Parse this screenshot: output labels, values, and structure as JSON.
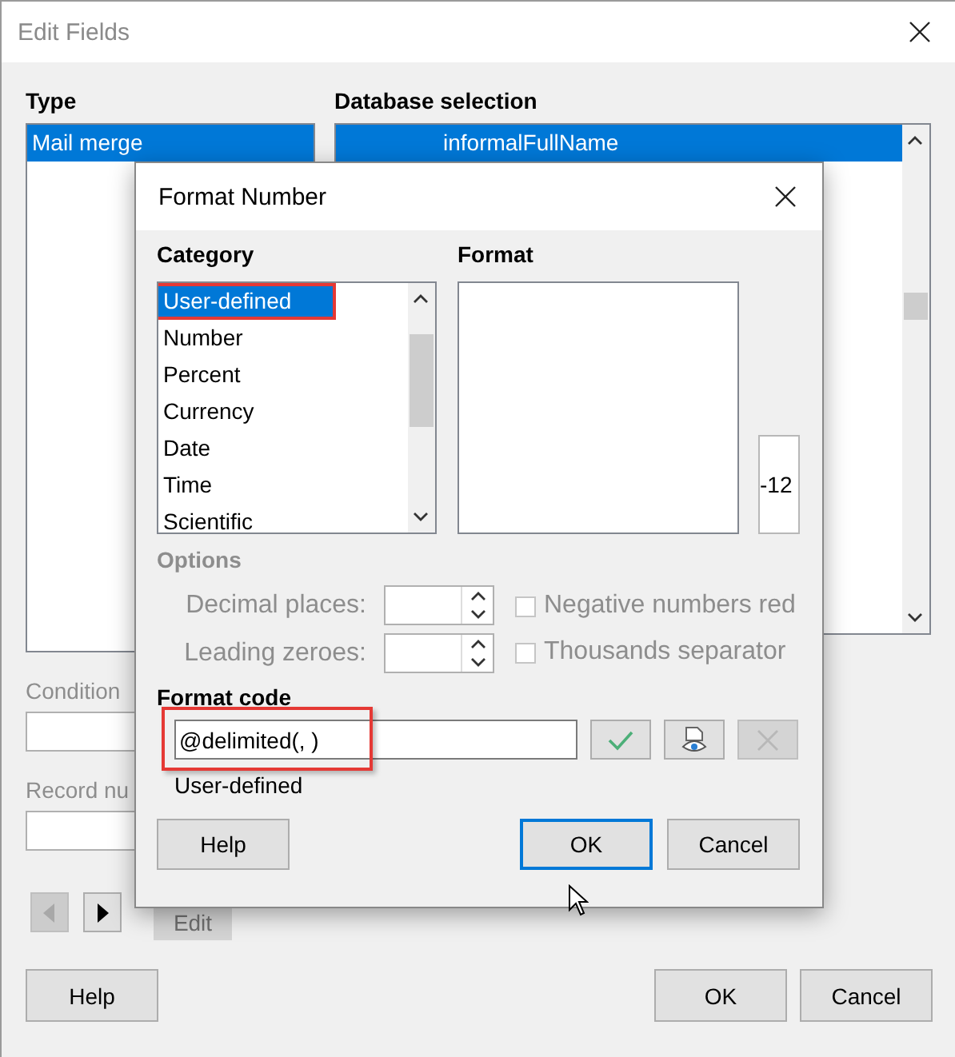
{
  "window": {
    "title": "Edit Fields"
  },
  "type_panel": {
    "label": "Type",
    "items": [
      {
        "label": "Mail merge",
        "selected": true
      }
    ]
  },
  "database_selection": {
    "label": "Database selection",
    "items": [
      {
        "label": "informalFullName",
        "selected": true
      }
    ]
  },
  "condition": {
    "label": "Condition"
  },
  "record_number": {
    "label": "Record nu"
  },
  "navigation": [
    {
      "kind": "previous",
      "disabled": true
    },
    {
      "kind": "next",
      "disabled": false
    }
  ],
  "edit_button": {
    "label": "Edit",
    "disabled": true
  },
  "buttons": [
    {
      "label": "Help",
      "kind": "help"
    },
    {
      "label": "OK",
      "kind": "action"
    },
    {
      "label": "Cancel",
      "kind": "action"
    }
  ],
  "format_number": {
    "title": "Format Number",
    "category": {
      "label": "Category",
      "items": [
        {
          "label": "User-defined",
          "selected": true,
          "highlighted": true
        },
        {
          "label": "Number",
          "selected": false,
          "highlighted": false
        },
        {
          "label": "Percent",
          "selected": false,
          "highlighted": false
        },
        {
          "label": "Currency",
          "selected": false,
          "highlighted": false
        },
        {
          "label": "Date",
          "selected": false,
          "highlighted": false
        },
        {
          "label": "Time",
          "selected": false,
          "highlighted": false
        },
        {
          "label": "Scientific",
          "selected": false,
          "highlighted": false
        }
      ]
    },
    "format": {
      "label": "Format"
    },
    "preview": "-12",
    "options": {
      "label": "Options",
      "disabled": true,
      "spinners": [
        {
          "label": "Decimal places:"
        },
        {
          "label": "Leading zeroes:"
        }
      ],
      "checkboxes": [
        {
          "label": "Negative numbers red",
          "checked": false
        },
        {
          "label": "Thousands separator",
          "checked": false
        }
      ]
    },
    "format_code": {
      "label": "Format code",
      "value": "@delimited(, )",
      "highlighted": true
    },
    "tool_buttons": [
      {
        "kind": "add",
        "disabled": false
      },
      {
        "kind": "comment",
        "disabled": false
      },
      {
        "kind": "remove",
        "disabled": true
      }
    ],
    "description": "User-defined",
    "buttons": [
      {
        "label": "Help",
        "kind": "help",
        "focused": false
      },
      {
        "label": "OK",
        "kind": "action",
        "focused": true
      },
      {
        "label": "Cancel",
        "kind": "action",
        "focused": false
      }
    ]
  }
}
